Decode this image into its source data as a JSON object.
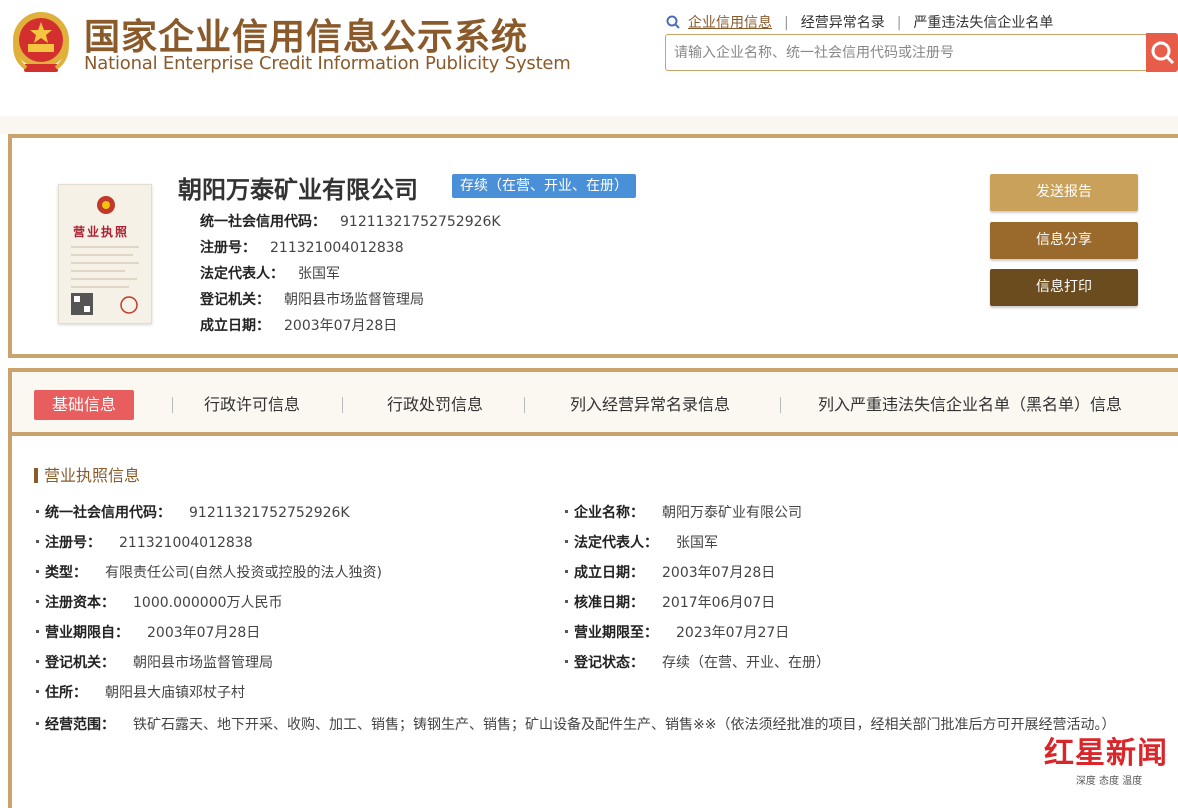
{
  "header": {
    "title_cn": "国家企业信用信息公示系统",
    "title_en": "National Enterprise Credit Information Publicity System",
    "nav": [
      "企业信用信息",
      "经营异常名录",
      "严重违法失信企业名单"
    ],
    "search_placeholder": "请输入企业名称、统一社会信用代码或注册号",
    "accent_color": "#8a5a2b",
    "search_button_color": "#e85d4a"
  },
  "company": {
    "name": "朝阳万泰矿业有限公司",
    "status": "存续（在营、开业、在册）",
    "license_label": "营业执照",
    "lines": [
      {
        "label": "统一社会信用代码：",
        "value": "91211321752752926K"
      },
      {
        "label": "注册号：",
        "value": "211321004012838"
      },
      {
        "label": "法定代表人：",
        "value": "张国军"
      },
      {
        "label": "登记机关：",
        "value": "朝阳县市场监督管理局"
      },
      {
        "label": "成立日期：",
        "value": "2003年07月28日"
      }
    ],
    "actions": [
      {
        "label": "发送报告",
        "color": "#c9a15b"
      },
      {
        "label": "信息分享",
        "color": "#9a6a2c"
      },
      {
        "label": "信息打印",
        "color": "#6b4c1f"
      }
    ]
  },
  "tabs": [
    {
      "label": "基础信息",
      "active": true
    },
    {
      "label": "行政许可信息",
      "active": false
    },
    {
      "label": "行政处罚信息",
      "active": false
    },
    {
      "label": "列入经营异常名录信息",
      "active": false
    },
    {
      "label": "列入严重违法失信企业名单（黑名单）信息",
      "active": false
    }
  ],
  "section": {
    "title": "营业执照信息",
    "left_fields": [
      {
        "label": "统一社会信用代码：",
        "value": "91211321752752926K"
      },
      {
        "label": "注册号：",
        "value": "211321004012838"
      },
      {
        "label": "类型：",
        "value": "有限责任公司(自然人投资或控股的法人独资)"
      },
      {
        "label": "注册资本：",
        "value": "1000.000000万人民币"
      },
      {
        "label": "营业期限自：",
        "value": "2003年07月28日"
      },
      {
        "label": "登记机关：",
        "value": "朝阳县市场监督管理局"
      },
      {
        "label": "住所：",
        "value": "朝阳县大庙镇邓杖子村"
      }
    ],
    "right_fields": [
      {
        "label": "企业名称：",
        "value": "朝阳万泰矿业有限公司"
      },
      {
        "label": "法定代表人：",
        "value": "张国军"
      },
      {
        "label": "成立日期：",
        "value": "2003年07月28日"
      },
      {
        "label": "核准日期：",
        "value": "2017年06月07日"
      },
      {
        "label": "营业期限至：",
        "value": "2023年07月27日"
      },
      {
        "label": "登记状态：",
        "value": "存续（在营、开业、在册）"
      }
    ],
    "scope_label": "经营范围：",
    "scope_value": "铁矿石露天、地下开采、收购、加工、销售；铸钢生产、销售；矿山设备及配件生产、销售※※（依法须经批准的项目，经相关部门批准后方可开展经营活动。）"
  },
  "watermark": {
    "main": "红星新闻",
    "sub": "深度 态度 温度"
  }
}
